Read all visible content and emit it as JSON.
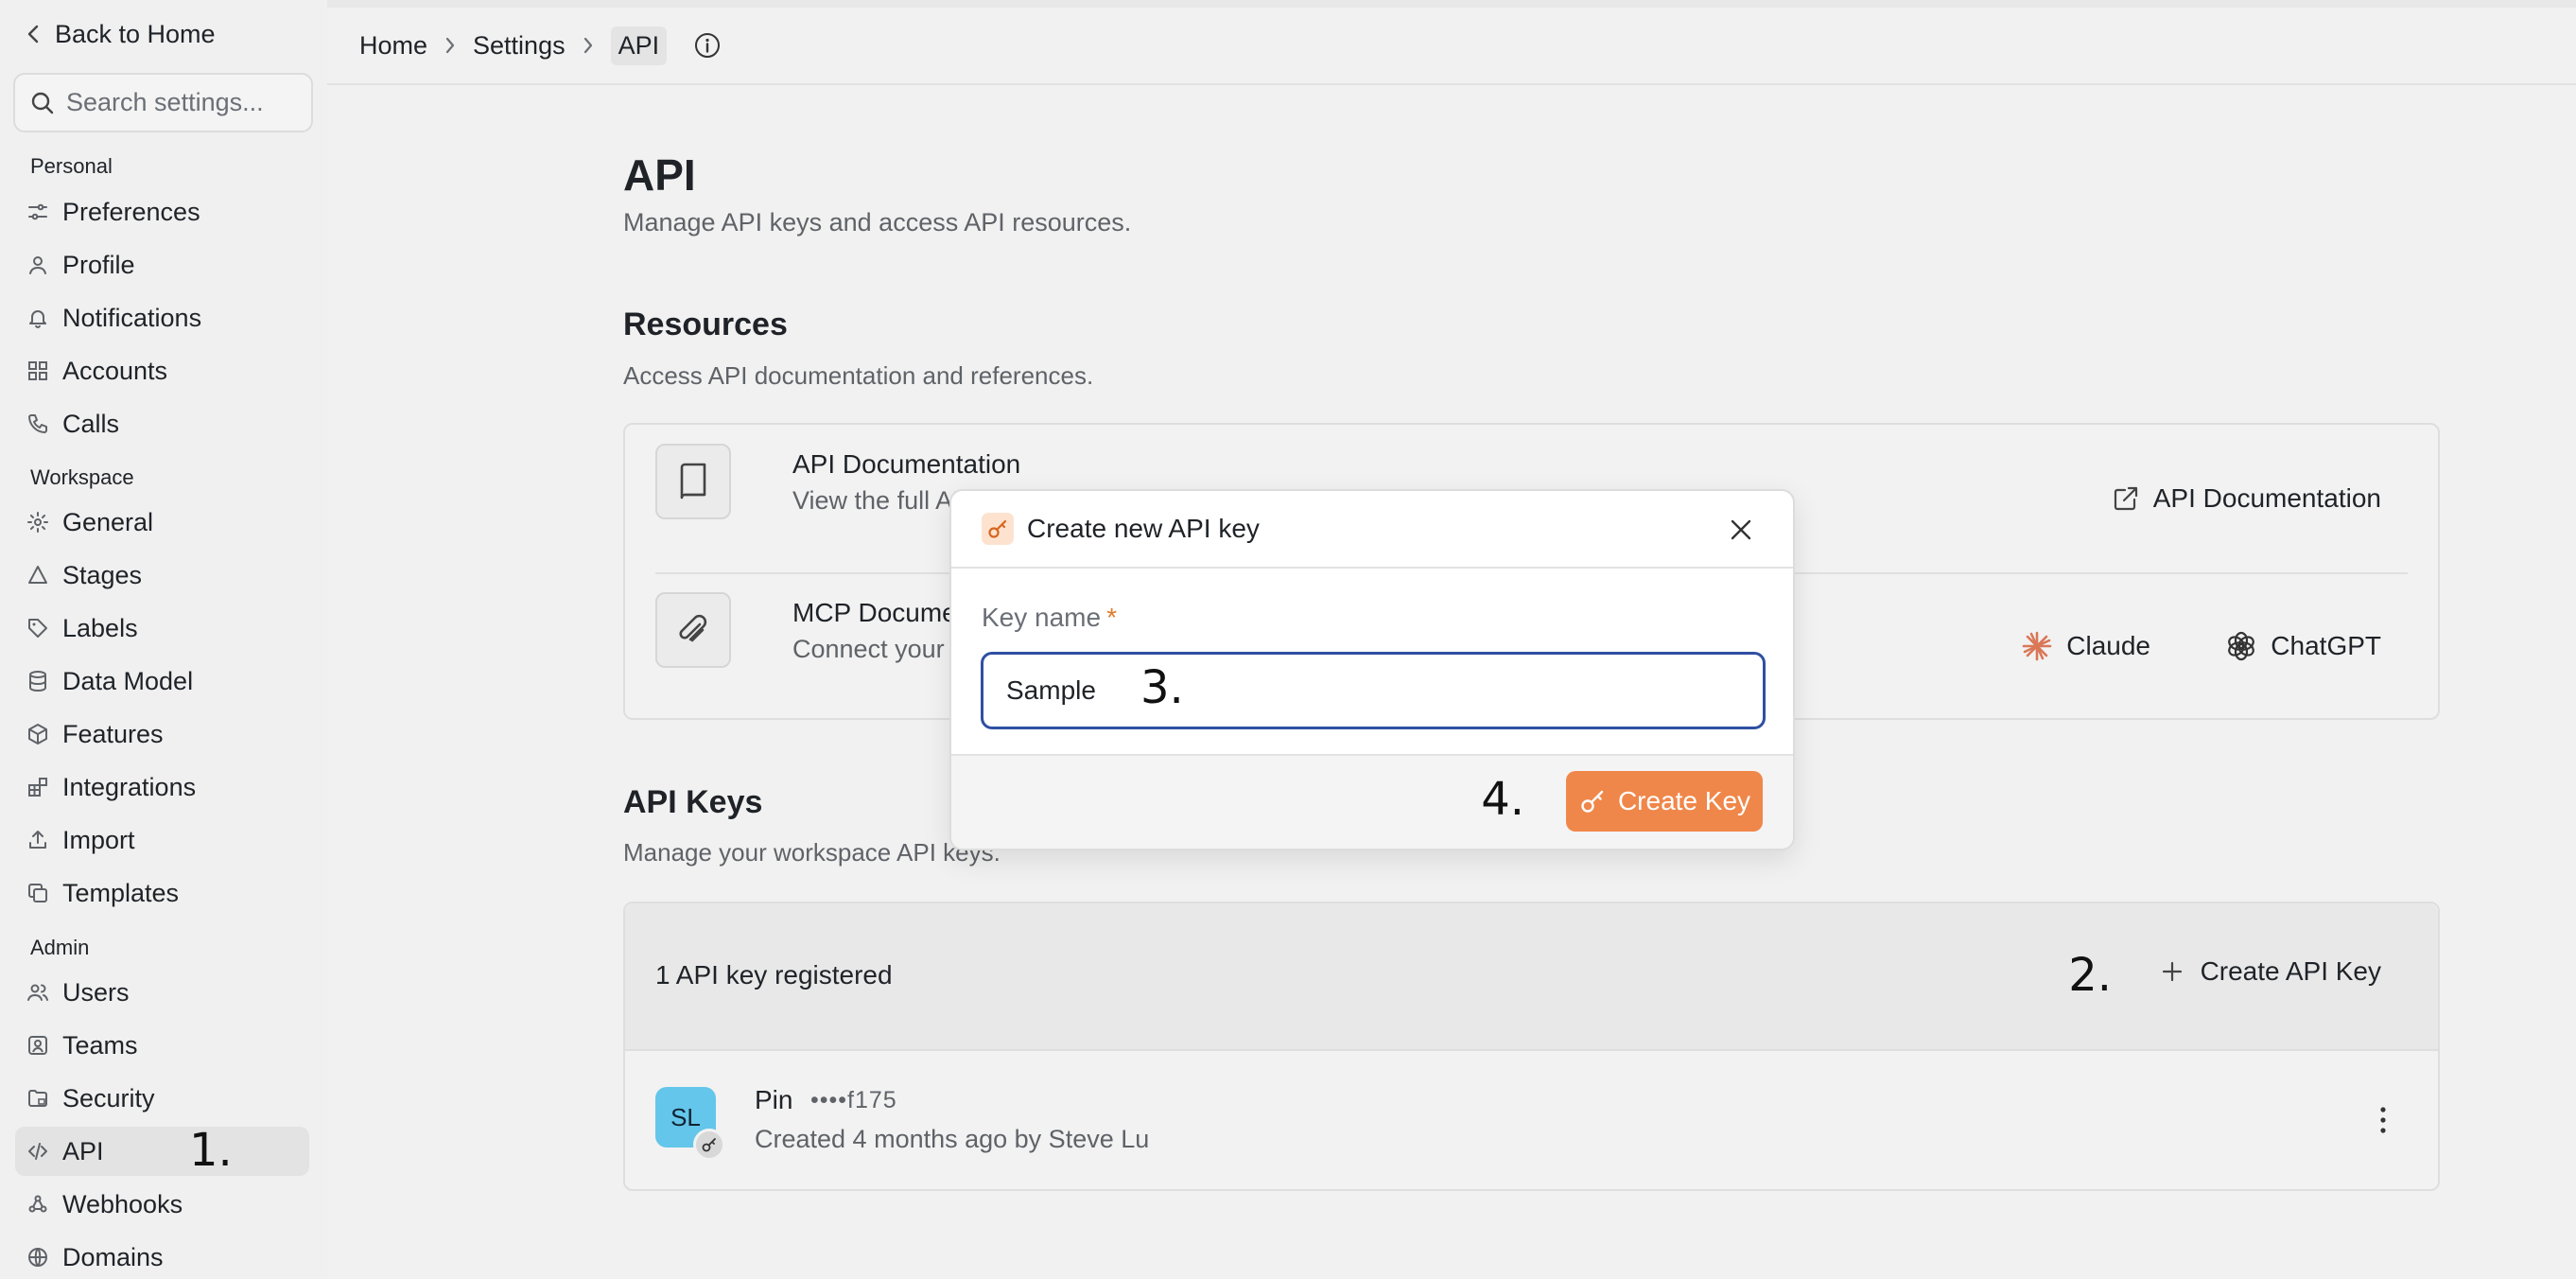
{
  "sidebar": {
    "back_label": "Back to Home",
    "search_placeholder": "Search settings...",
    "sections": {
      "personal": "Personal",
      "workspace": "Workspace",
      "admin": "Admin"
    },
    "items": {
      "preferences": "Preferences",
      "profile": "Profile",
      "notifications": "Notifications",
      "accounts": "Accounts",
      "calls": "Calls",
      "general": "General",
      "stages": "Stages",
      "labels": "Labels",
      "data_model": "Data Model",
      "features": "Features",
      "integrations": "Integrations",
      "import": "Import",
      "templates": "Templates",
      "users": "Users",
      "teams": "Teams",
      "security": "Security",
      "api": "API",
      "webhooks": "Webhooks",
      "domains": "Domains"
    },
    "active_item": "API"
  },
  "breadcrumb": {
    "home": "Home",
    "settings": "Settings",
    "current": "API"
  },
  "page": {
    "title": "API",
    "subtitle": "Manage API keys and access API resources."
  },
  "resources": {
    "title": "Resources",
    "subtitle": "Access API documentation and references.",
    "api_docs": {
      "title": "API Documentation",
      "description": "View the full API",
      "action": "API Documentation"
    },
    "mcp_docs": {
      "title": "MCP Documen",
      "description": "Connect your AI",
      "action_claude": "Claude",
      "action_chatgpt": "ChatGPT"
    }
  },
  "api_keys": {
    "title": "API Keys",
    "subtitle": "Manage your workspace API keys.",
    "count_label": "1 API key registered",
    "create_label": "Create API Key",
    "keys": [
      {
        "initials": "SL",
        "name": "Pin",
        "masked": "••••f175",
        "meta": "Created 4 months ago by Steve Lu"
      }
    ]
  },
  "modal": {
    "title": "Create new API key",
    "field_label": "Key name",
    "required_marker": "*",
    "field_value": "Sample",
    "submit_label": "Create Key"
  },
  "annotations": {
    "step1": "1.",
    "step2": "2.",
    "step3": "3.",
    "step4": "4."
  },
  "colors": {
    "accent": "#f0874a",
    "focus_border": "#2f4fa2",
    "avatar": "#63c6ea"
  }
}
